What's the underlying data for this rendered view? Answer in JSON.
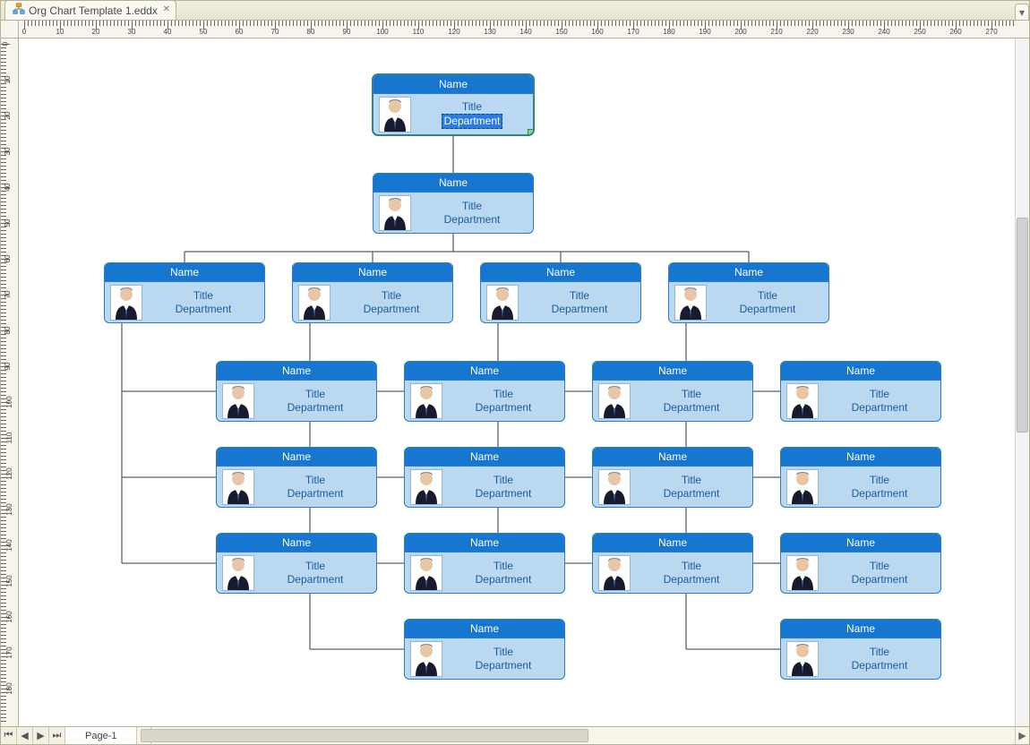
{
  "tab": {
    "label": "Org Chart Template 1.eddx"
  },
  "page": {
    "tab_label": "Page-1"
  },
  "rulers": {
    "h_labels": [
      0,
      10,
      20,
      30,
      40,
      50,
      60,
      70,
      80,
      90,
      100,
      110,
      120,
      130,
      140,
      150,
      160,
      170,
      180,
      190,
      200,
      210,
      220,
      230,
      240,
      250,
      260,
      270
    ],
    "v_labels": [
      0,
      10,
      20,
      30,
      40,
      50,
      60,
      70,
      80,
      90,
      100,
      110,
      120,
      130,
      140,
      150,
      160,
      170,
      180
    ]
  },
  "cards": {
    "default": {
      "name": "Name",
      "title": "Title",
      "department": "Department"
    },
    "top_editing": {
      "name": "Name",
      "title": "Title",
      "department": "Department"
    }
  },
  "chart_data": {
    "type": "org-chart",
    "root": {
      "name": "Name",
      "title": "Title",
      "department": "Department",
      "editing": true,
      "children": [
        {
          "name": "Name",
          "title": "Title",
          "department": "Department",
          "children": [
            {
              "name": "Name",
              "title": "Title",
              "department": "Department",
              "children": [
                {
                  "name": "Name",
                  "title": "Title",
                  "department": "Department"
                },
                {
                  "name": "Name",
                  "title": "Title",
                  "department": "Department"
                },
                {
                  "name": "Name",
                  "title": "Title",
                  "department": "Department"
                }
              ]
            },
            {
              "name": "Name",
              "title": "Title",
              "department": "Department",
              "children": [
                {
                  "name": "Name",
                  "title": "Title",
                  "department": "Department"
                },
                {
                  "name": "Name",
                  "title": "Title",
                  "department": "Department"
                },
                {
                  "name": "Name",
                  "title": "Title",
                  "department": "Department"
                },
                {
                  "name": "Name",
                  "title": "Title",
                  "department": "Department"
                }
              ]
            },
            {
              "name": "Name",
              "title": "Title",
              "department": "Department",
              "children": [
                {
                  "name": "Name",
                  "title": "Title",
                  "department": "Department"
                },
                {
                  "name": "Name",
                  "title": "Title",
                  "department": "Department"
                },
                {
                  "name": "Name",
                  "title": "Title",
                  "department": "Department"
                }
              ]
            },
            {
              "name": "Name",
              "title": "Title",
              "department": "Department",
              "children": [
                {
                  "name": "Name",
                  "title": "Title",
                  "department": "Department"
                },
                {
                  "name": "Name",
                  "title": "Title",
                  "department": "Department"
                },
                {
                  "name": "Name",
                  "title": "Title",
                  "department": "Department"
                },
                {
                  "name": "Name",
                  "title": "Title",
                  "department": "Department"
                }
              ]
            }
          ]
        }
      ]
    }
  },
  "tooltips": {
    "add_child": "+"
  }
}
